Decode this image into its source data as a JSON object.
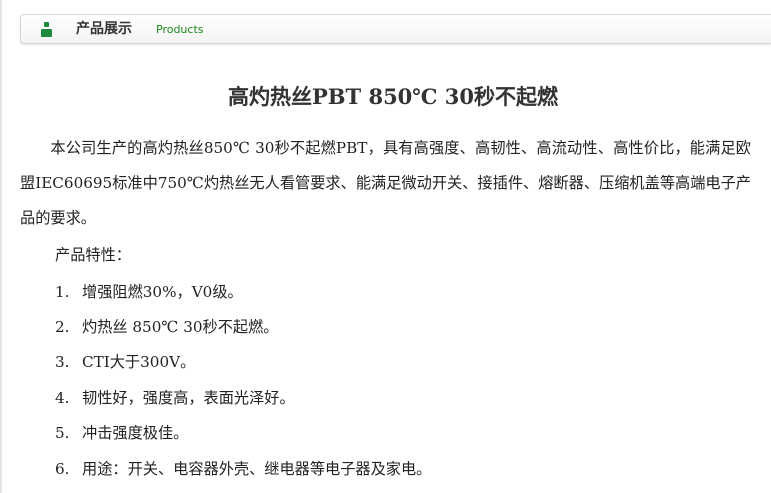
{
  "header": {
    "title": "产品展示",
    "subtitle": "Products",
    "icon": "product-icon",
    "accent_color": "#1c8a3a"
  },
  "article": {
    "title": "高灼热丝PBT 850℃ 30秒不起燃",
    "intro": "本公司生产的高灼热丝850℃ 30秒不起燃PBT，具有高强度、高韧性、高流动性、高性价比，能满足欧盟IEC60695标准中750℃灼热丝无人看管要求、能满足微动开关、接插件、熔断器、压缩机盖等高端电子产品的要求。",
    "features_heading": "产品特性：",
    "features": [
      {
        "num": "1.",
        "text": "增强阻燃30%，V0级。"
      },
      {
        "num": "2.",
        "text": "灼热丝 850℃ 30秒不起燃。"
      },
      {
        "num": "3.",
        "text": "CTI大于300V。"
      },
      {
        "num": "4.",
        "text": "韧性好，强度高，表面光泽好。"
      },
      {
        "num": "5.",
        "text": "冲击强度极佳。"
      },
      {
        "num": "6.",
        "text": "用途：开关、电容器外壳、继电器等电子器及家电。"
      }
    ]
  }
}
